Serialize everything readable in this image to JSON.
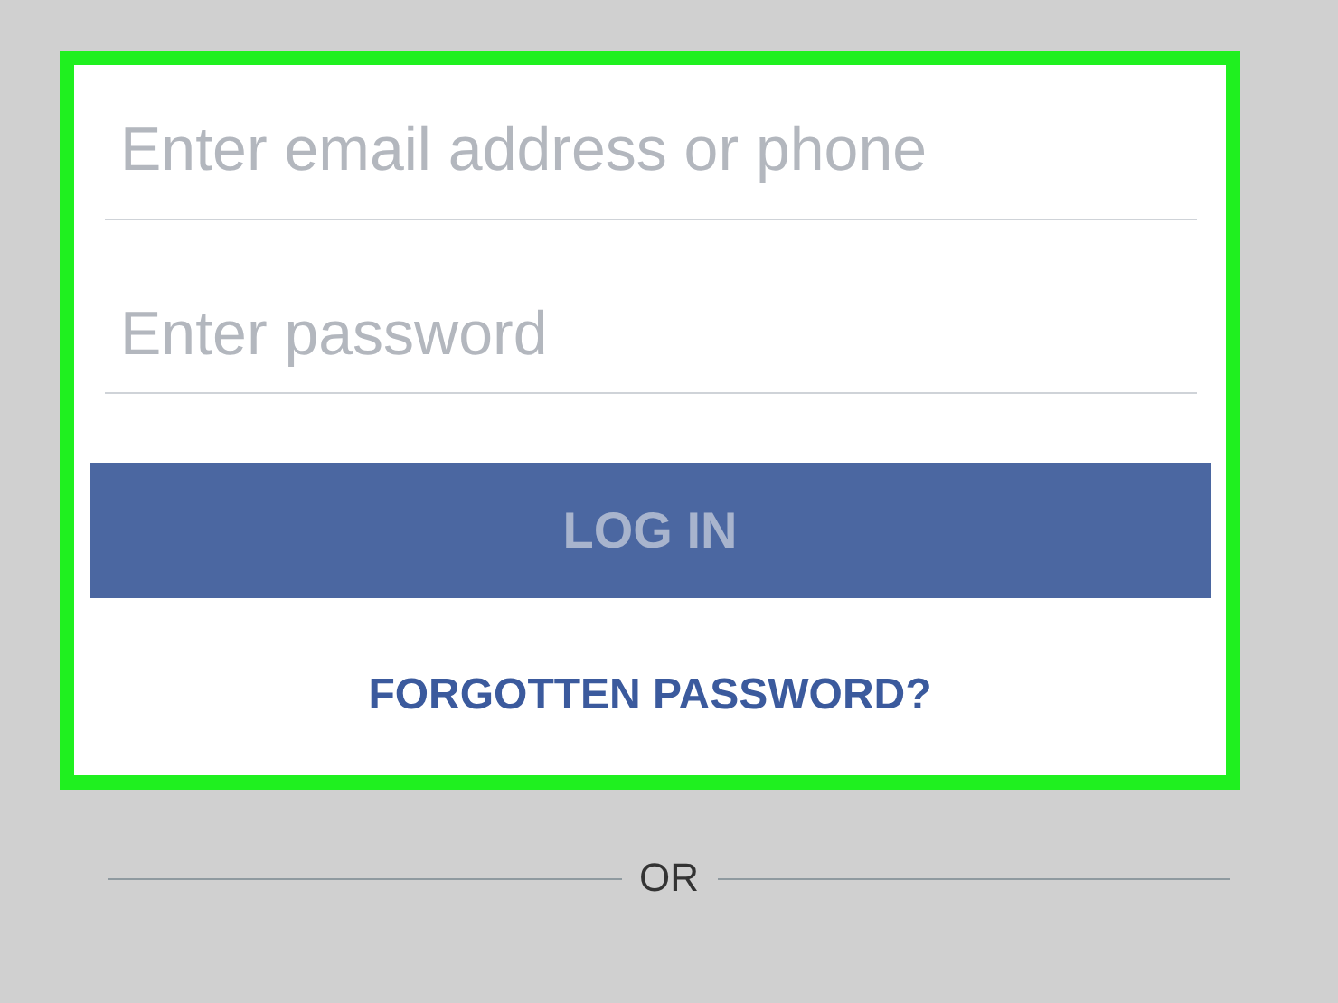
{
  "email_field": {
    "placeholder": "Enter email address or phone"
  },
  "password_field": {
    "placeholder": "Enter password"
  },
  "login_button": {
    "label": "LOG IN",
    "disabled": true
  },
  "forgot_link": {
    "label": "FORGOTTEN PASSWORD?"
  },
  "divider": {
    "label": "OR"
  }
}
